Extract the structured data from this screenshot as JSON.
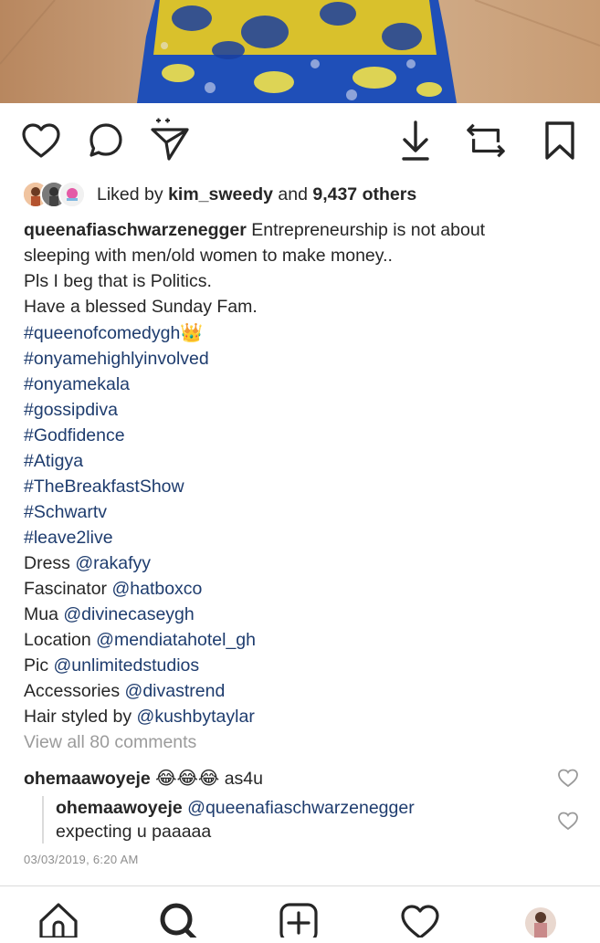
{
  "post": {
    "likes": {
      "prefix": "Liked by",
      "user": "kim_sweedy",
      "joiner": "and",
      "others": "9,437 others"
    },
    "caption": {
      "author": "queenafiaschwarzenegger",
      "first_text": "Entrepreneurship is not about",
      "line2": "sleeping  with men/old women to make money..",
      "line3": "Pls I beg that is Politics.",
      "line4": "Have a blessed Sunday Fam.",
      "hashtags": [
        "#queenofcomedygh",
        "#onyamehighlyinvolved",
        "#onyamekala",
        "#gossipdiva",
        "#Godfidence",
        "#Atigya",
        "#TheBreakfastShow",
        "#Schwartv",
        "#leave2live"
      ],
      "crown_emoji": "👑",
      "credits": [
        {
          "label": "Dress",
          "handle": "@rakafyy"
        },
        {
          "label": "Fascinator",
          "handle": "@hatboxco"
        },
        {
          "label": "Mua",
          "handle": "@divinecaseygh"
        },
        {
          "label": "Location",
          "handle": "@mendiatahotel_gh"
        },
        {
          "label": "Pic",
          "handle": "@unlimitedstudios"
        },
        {
          "label": "Accessories",
          "handle": "@divastrend"
        },
        {
          "label": "Hair styled by",
          "handle": "@kushbytaylar"
        }
      ]
    },
    "view_all_comments": "View all 80 comments",
    "comments": [
      {
        "user": "ohemaawoyeje",
        "emojis": "😂😂😂",
        "text": "as4u"
      }
    ],
    "reply": {
      "user": "ohemaawoyeje",
      "mention": "@queenafiaschwarzenegger",
      "text": "expecting u paaaaa"
    },
    "timestamp": "03/03/2019, 6:20 AM"
  },
  "icons": {
    "like": "heart-icon",
    "comment": "comment-bubble-icon",
    "share": "send-plus-icon",
    "download": "download-icon",
    "repost": "repost-icon",
    "save": "bookmark-icon",
    "tab_home": "home-icon",
    "tab_search": "search-icon",
    "tab_add": "add-post-icon",
    "tab_activity": "heart-icon",
    "tab_profile": "profile-avatar"
  },
  "colors": {
    "hashtag": "#1e3c6e",
    "muted": "#8e8e8e",
    "text": "#262626"
  }
}
